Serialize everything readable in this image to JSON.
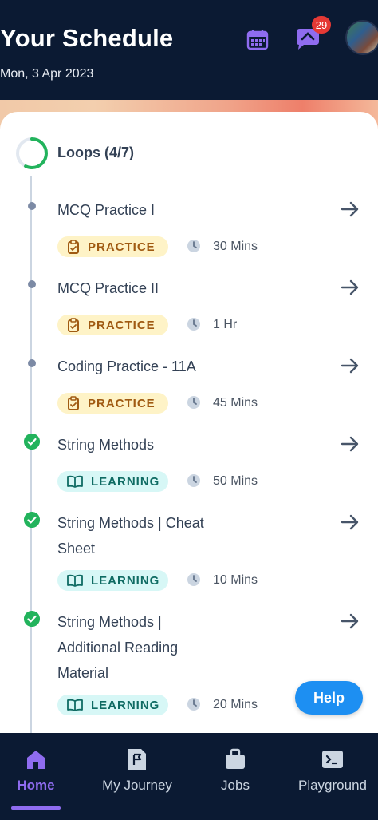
{
  "header": {
    "title": "Your Schedule",
    "date": "Mon, 3 Apr 2023",
    "notification_count": "29"
  },
  "loops": {
    "label": "Loops (4/7)",
    "completed": 4,
    "total": 7
  },
  "items": [
    {
      "title": "MCQ Practice I",
      "tag": "PRACTICE",
      "duration": "30 Mins",
      "done": false
    },
    {
      "title": "MCQ Practice II",
      "tag": "PRACTICE",
      "duration": "1 Hr",
      "done": false
    },
    {
      "title": "Coding Practice - 11A",
      "tag": "PRACTICE",
      "duration": "45 Mins",
      "done": false
    },
    {
      "title": "String Methods",
      "tag": "LEARNING",
      "duration": "50 Mins",
      "done": true
    },
    {
      "title": "String Methods | Cheat Sheet",
      "tag": "LEARNING",
      "duration": "10 Mins",
      "done": true
    },
    {
      "title": "String Methods | Additional Reading Material",
      "tag": "LEARNING",
      "duration": "20 Mins",
      "done": true
    }
  ],
  "help_label": "Help",
  "nav": [
    {
      "label": "Home",
      "icon": "home-icon",
      "active": true
    },
    {
      "label": "My Journey",
      "icon": "journey-icon",
      "active": false
    },
    {
      "label": "Jobs",
      "icon": "briefcase-icon",
      "active": false
    },
    {
      "label": "Playground",
      "icon": "terminal-icon",
      "active": false
    }
  ],
  "colors": {
    "header_bg": "#0b1a33",
    "accent": "#8f6cf0",
    "success": "#22b35c",
    "help": "#1d8ff2"
  }
}
